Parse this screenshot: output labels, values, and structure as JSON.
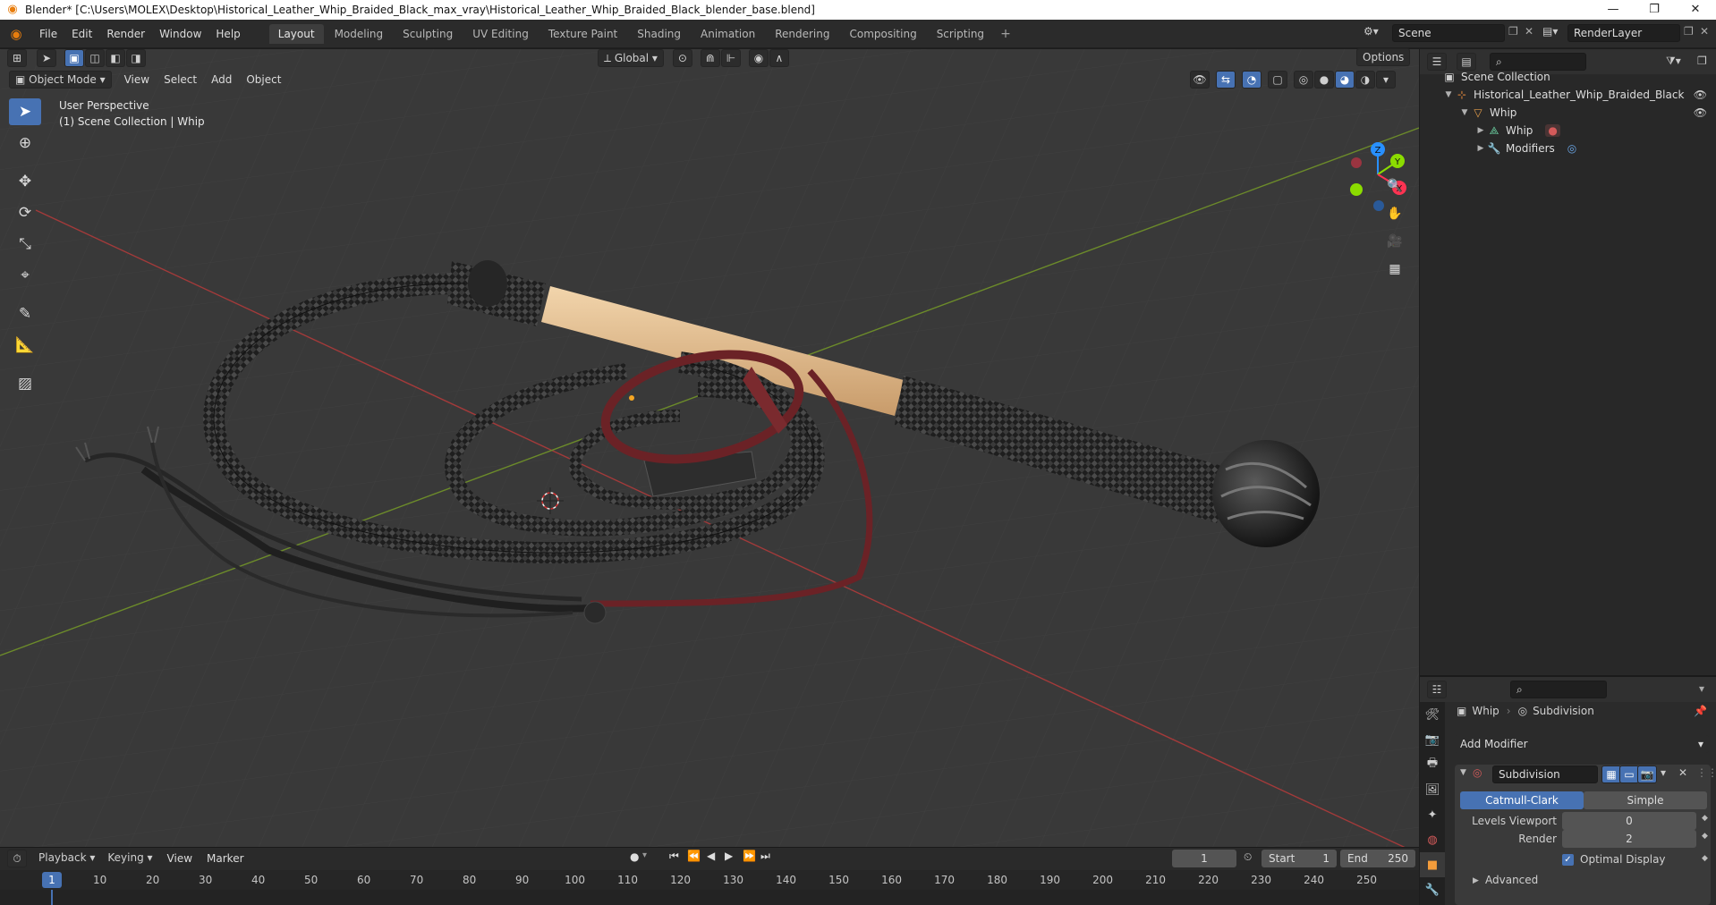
{
  "window": {
    "title": "Blender* [C:\\Users\\MOLEX\\Desktop\\Historical_Leather_Whip_Braided_Black_max_vray\\Historical_Leather_Whip_Braided_Black_blender_base.blend]",
    "minimize": "—",
    "restore": "❐",
    "close": "✕"
  },
  "menu": {
    "items": [
      "File",
      "Edit",
      "Render",
      "Window",
      "Help"
    ]
  },
  "workspaces": {
    "tabs": [
      "Layout",
      "Modeling",
      "Sculpting",
      "UV Editing",
      "Texture Paint",
      "Shading",
      "Animation",
      "Rendering",
      "Compositing",
      "Scripting"
    ],
    "active": "Layout",
    "add": "+"
  },
  "scene": {
    "name": "Scene",
    "render_layer": "RenderLayer"
  },
  "viewport_header": {
    "mode": "Object Mode",
    "menus": [
      "View",
      "Select",
      "Add",
      "Object"
    ],
    "transform_orientation": "Global",
    "options": "Options"
  },
  "viewport": {
    "perspective": "User Perspective",
    "collection_info": "(1) Scene Collection | Whip"
  },
  "gizmo": {
    "z": "Z",
    "y": "Y",
    "x": "X"
  },
  "outliner": {
    "root": "Scene Collection",
    "collection": "Historical_Leather_Whip_Braided_Black",
    "object": "Whip",
    "mesh": "Whip",
    "modifiers": "Modifiers"
  },
  "properties": {
    "breadcrumb_object": "Whip",
    "breadcrumb_modifier": "Subdivision",
    "add_modifier": "Add Modifier",
    "modifier_name": "Subdivision",
    "type_catmull": "Catmull-Clark",
    "type_simple": "Simple",
    "levels_viewport_label": "Levels Viewport",
    "levels_viewport_value": "0",
    "render_label": "Render",
    "render_value": "2",
    "optimal_display": "Optimal Display",
    "advanced": "Advanced"
  },
  "timeline": {
    "menus": [
      "Playback",
      "Keying",
      "View",
      "Marker"
    ],
    "current_frame": "1",
    "start_label": "Start",
    "start_value": "1",
    "end_label": "End",
    "end_value": "250",
    "ruler": [
      "1",
      "10",
      "20",
      "30",
      "40",
      "50",
      "60",
      "70",
      "80",
      "90",
      "100",
      "110",
      "120",
      "130",
      "140",
      "150",
      "160",
      "170",
      "180",
      "190",
      "200",
      "210",
      "220",
      "230",
      "240",
      "250"
    ]
  },
  "colors": {
    "accent_blue": "#4772b3",
    "active_tab": "#3d3d3d",
    "axis_x": "#ff3352",
    "axis_y": "#8bdc00",
    "axis_z": "#2890ff"
  }
}
